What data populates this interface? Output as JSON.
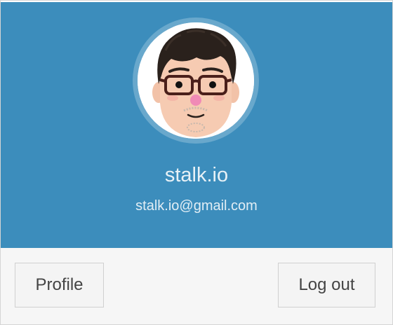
{
  "user": {
    "name": "stalk.io",
    "email": "stalk.io@gmail.com"
  },
  "footer": {
    "profile_label": "Profile",
    "logout_label": "Log out"
  },
  "colors": {
    "header_bg": "#3c8dbc",
    "footer_bg": "#f6f6f6"
  },
  "icons": {
    "avatar": "cartoon-face-with-glasses"
  }
}
